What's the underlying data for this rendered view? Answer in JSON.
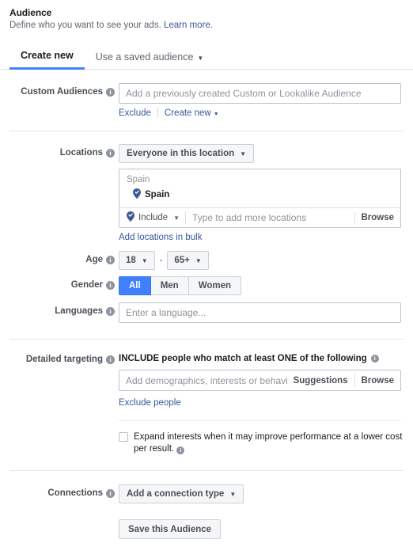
{
  "header": {
    "title": "Audience",
    "subtitle": "Define who you want to see your ads.",
    "learn_more": "Learn more.",
    "learn_more_color": "#385898"
  },
  "tabs": [
    {
      "label": "Create new",
      "active": true
    },
    {
      "label": "Use a saved audience",
      "active": false,
      "caret": "▼"
    }
  ],
  "custom_audiences": {
    "label": "Custom Audiences",
    "info": "i",
    "placeholder": "Add a previously created Custom or Lookalike Audience",
    "value": "",
    "exclude_link": "Exclude",
    "create_new_link": "Create new",
    "create_new_caret": "▼"
  },
  "locations": {
    "label": "Locations",
    "info": "i",
    "scope_dropdown": "Everyone in this location",
    "scope_caret": "▼",
    "box_header": "Spain",
    "selected": [
      {
        "name": "Spain",
        "icon": "location-pin-check-icon"
      }
    ],
    "include_label": "Include",
    "include_caret": "▼",
    "include_icon": "location-pin-check-icon",
    "type_placeholder": "Type to add more locations",
    "browse_label": "Browse",
    "bulk_link": "Add locations in bulk"
  },
  "age": {
    "label": "Age",
    "info": "i",
    "min": "18",
    "max": "65+",
    "separator": "-",
    "caret": "▼"
  },
  "gender": {
    "label": "Gender",
    "info": "i",
    "options": [
      {
        "label": "All",
        "selected": true
      },
      {
        "label": "Men",
        "selected": false
      },
      {
        "label": "Women",
        "selected": false
      }
    ],
    "selected_color": "#4080ff"
  },
  "languages": {
    "label": "Languages",
    "info": "i",
    "placeholder": "Enter a language...",
    "value": ""
  },
  "detailed_targeting": {
    "label": "Detailed targeting",
    "info": "i",
    "include_title": "INCLUDE people who match at least ONE of the following",
    "include_title_info": "i",
    "placeholder": "Add demographics, interests or behaviours",
    "value": "",
    "suggestions_label": "Suggestions",
    "browse_label": "Browse",
    "exclude_link": "Exclude people",
    "expand_checkbox": {
      "checked": false,
      "text": "Expand interests when it may improve performance at a lower cost per result.",
      "info": "i"
    }
  },
  "connections": {
    "label": "Connections",
    "info": "i",
    "dropdown": "Add a connection type",
    "caret": "▼"
  },
  "save": {
    "label": "Save this Audience"
  }
}
